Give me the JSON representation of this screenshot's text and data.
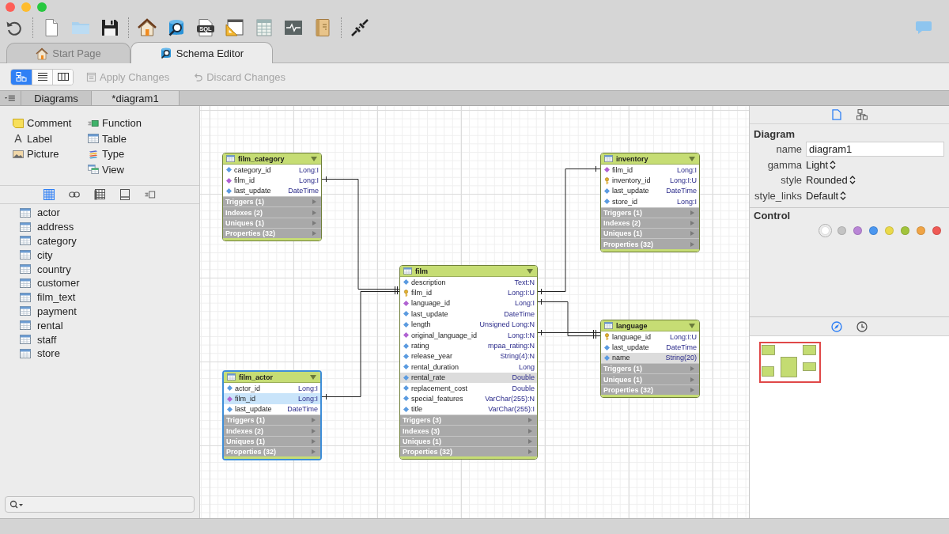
{
  "toolbar": {
    "groups": [
      [
        {
          "kind": "undo"
        }
      ],
      [
        {
          "kind": "new"
        },
        {
          "kind": "open"
        },
        {
          "kind": "save"
        }
      ],
      [
        {
          "kind": "home"
        },
        {
          "kind": "schema"
        },
        {
          "kind": "sql",
          "text": "SQL"
        },
        {
          "kind": "design"
        },
        {
          "kind": "data"
        },
        {
          "kind": "monitor"
        },
        {
          "kind": "notes"
        }
      ],
      [
        {
          "kind": "connect"
        }
      ]
    ]
  },
  "tabs": [
    {
      "kind": "home",
      "label": "Start Page",
      "selected": false
    },
    {
      "kind": "schema",
      "label": "Schema Editor",
      "selected": true
    }
  ],
  "view_modes": [
    {
      "kind": "diagram",
      "selected": true
    },
    {
      "kind": "list",
      "selected": false
    },
    {
      "kind": "columns",
      "selected": false
    }
  ],
  "actions": [
    {
      "kind": "apply",
      "label": "Apply Changes",
      "disabled": true
    },
    {
      "kind": "discard",
      "label": "Discard Changes",
      "disabled": true
    }
  ],
  "panel_tabs": [
    {
      "label": "Diagrams",
      "selected": false
    },
    {
      "label": "*diagram1",
      "selected": true
    }
  ],
  "sidebar": {
    "palette": [
      [
        {
          "kind": "comment",
          "label": "Comment"
        },
        {
          "kind": "label",
          "label": "Label",
          "glyph": "A"
        },
        {
          "kind": "picture",
          "label": "Picture"
        }
      ],
      [
        {
          "kind": "function",
          "label": "Function"
        },
        {
          "kind": "table",
          "label": "Table"
        },
        {
          "kind": "type",
          "label": "Type"
        },
        {
          "kind": "view",
          "label": "View"
        }
      ]
    ],
    "filters": [
      {
        "kind": "tables",
        "selected": true
      },
      {
        "kind": "links",
        "selected": false
      },
      {
        "kind": "grid",
        "selected": false
      },
      {
        "kind": "panel",
        "selected": false
      },
      {
        "kind": "functions",
        "selected": false
      }
    ],
    "tables": [
      "actor",
      "address",
      "category",
      "city",
      "country",
      "customer",
      "film_text",
      "payment",
      "rental",
      "staff",
      "store"
    ]
  },
  "diagram": {
    "tables": [
      {
        "name": "film_category",
        "selected": false,
        "columns": [
          {
            "name": "category_id",
            "type": "Long:I",
            "kind": "plain",
            "selected": false,
            "marked": false
          },
          {
            "name": "film_id",
            "type": "Long:I",
            "kind": "foreign",
            "selected": false,
            "marked": false
          },
          {
            "name": "last_update",
            "type": "DateTime",
            "kind": "plain",
            "selected": false,
            "marked": false
          }
        ],
        "sections": [
          "Triggers (1)",
          "Indexes (2)",
          "Uniques (1)",
          "Properties (32)"
        ]
      },
      {
        "name": "inventory",
        "selected": false,
        "columns": [
          {
            "name": "film_id",
            "type": "Long:I",
            "kind": "foreign",
            "selected": false,
            "marked": false
          },
          {
            "name": "inventory_id",
            "type": "Long:I:U",
            "kind": "primary",
            "selected": false,
            "marked": false
          },
          {
            "name": "last_update",
            "type": "DateTime",
            "kind": "plain",
            "selected": false,
            "marked": false
          },
          {
            "name": "store_id",
            "type": "Long:I",
            "kind": "plain",
            "selected": false,
            "marked": false
          }
        ],
        "sections": [
          "Triggers (1)",
          "Indexes (2)",
          "Uniques (1)",
          "Properties (32)"
        ]
      },
      {
        "name": "film",
        "selected": false,
        "columns": [
          {
            "name": "description",
            "type": "Text:N",
            "kind": "plain",
            "selected": false,
            "marked": false
          },
          {
            "name": "film_id",
            "type": "Long:I:U",
            "kind": "primary",
            "selected": false,
            "marked": false
          },
          {
            "name": "language_id",
            "type": "Long:I",
            "kind": "foreign",
            "selected": false,
            "marked": false
          },
          {
            "name": "last_update",
            "type": "DateTime",
            "kind": "plain",
            "selected": false,
            "marked": false
          },
          {
            "name": "length",
            "type": "Unsigned Long:N",
            "kind": "plain",
            "selected": false,
            "marked": false
          },
          {
            "name": "original_language_id",
            "type": "Long:I:N",
            "kind": "foreign",
            "selected": false,
            "marked": false
          },
          {
            "name": "rating",
            "type": "mpaa_rating:N",
            "kind": "plain",
            "selected": false,
            "marked": false
          },
          {
            "name": "release_year",
            "type": "String(4):N",
            "kind": "plain",
            "selected": false,
            "marked": false
          },
          {
            "name": "rental_duration",
            "type": "Long",
            "kind": "plain",
            "selected": false,
            "marked": false
          },
          {
            "name": "rental_rate",
            "type": "Double",
            "kind": "plain",
            "selected": false,
            "marked": true
          },
          {
            "name": "replacement_cost",
            "type": "Double",
            "kind": "plain",
            "selected": false,
            "marked": false
          },
          {
            "name": "special_features",
            "type": "VarChar(255):N",
            "kind": "plain",
            "selected": false,
            "marked": false
          },
          {
            "name": "title",
            "type": "VarChar(255):I",
            "kind": "plain",
            "selected": false,
            "marked": false
          }
        ],
        "sections": [
          "Triggers (3)",
          "Indexes (3)",
          "Uniques (1)",
          "Properties (32)"
        ]
      },
      {
        "name": "language",
        "selected": false,
        "columns": [
          {
            "name": "language_id",
            "type": "Long:I:U",
            "kind": "primary",
            "selected": false,
            "marked": false
          },
          {
            "name": "last_update",
            "type": "DateTime",
            "kind": "plain",
            "selected": false,
            "marked": false
          },
          {
            "name": "name",
            "type": "String(20)",
            "kind": "plain",
            "selected": false,
            "marked": true
          }
        ],
        "sections": [
          "Triggers (1)",
          "Uniques (1)",
          "Properties (32)"
        ]
      },
      {
        "name": "film_actor",
        "selected": true,
        "columns": [
          {
            "name": "actor_id",
            "type": "Long:I",
            "kind": "plain",
            "selected": false,
            "marked": false
          },
          {
            "name": "film_id",
            "type": "Long:I",
            "kind": "foreign",
            "selected": true,
            "marked": false
          },
          {
            "name": "last_update",
            "type": "DateTime",
            "kind": "plain",
            "selected": false,
            "marked": false
          }
        ],
        "sections": [
          "Triggers (1)",
          "Indexes (2)",
          "Uniques (1)",
          "Properties (32)"
        ]
      }
    ]
  },
  "inspector": {
    "tabs": [
      {
        "kind": "document",
        "selected": true
      },
      {
        "kind": "diagram",
        "selected": false
      }
    ],
    "title": "Diagram",
    "properties": [
      {
        "label": "name",
        "kind": "field",
        "value": "diagram1"
      },
      {
        "label": "gamma",
        "kind": "select",
        "value": "Light"
      },
      {
        "label": "style",
        "kind": "select",
        "value": "Rounded"
      },
      {
        "label": "style_links",
        "kind": "select",
        "value": "Default"
      }
    ],
    "control": {
      "title": "Control",
      "colors": [
        {
          "color": "#ffffff",
          "selected": true
        },
        {
          "color": "#c4c4c4",
          "selected": false
        },
        {
          "color": "#b985d6",
          "selected": false
        },
        {
          "color": "#4b97f0",
          "selected": false
        },
        {
          "color": "#ead94a",
          "selected": false
        },
        {
          "color": "#a2c43c",
          "selected": false
        },
        {
          "color": "#f0a445",
          "selected": false
        },
        {
          "color": "#ef5a55",
          "selected": false
        }
      ]
    },
    "bottom_tabs": [
      {
        "kind": "navigator",
        "selected": true
      },
      {
        "kind": "history",
        "selected": false
      }
    ]
  }
}
